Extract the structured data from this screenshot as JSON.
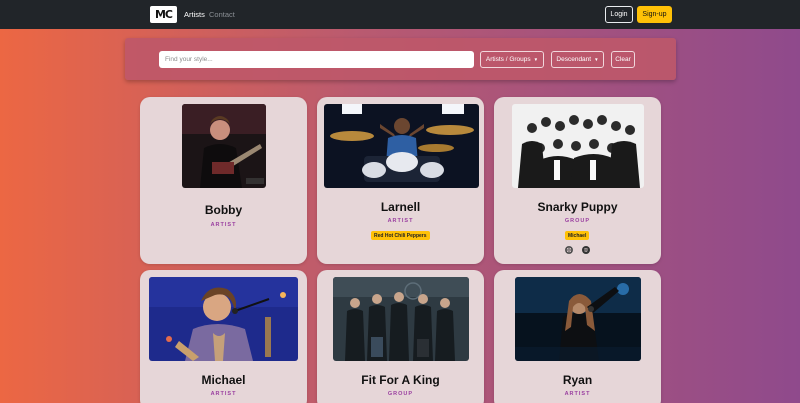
{
  "navbar": {
    "brand": "MC",
    "links": [
      "Artists",
      "Contact"
    ],
    "login_label": "Login",
    "signup_label": "Sign-up"
  },
  "filter": {
    "search_placeholder": "Find your style...",
    "type_label": "Artists / Groups",
    "order_label": "Descendant",
    "clear_label": "Clear"
  },
  "cards": [
    {
      "name": "Bobby",
      "kind": "ARTIST",
      "tags": [],
      "socials": []
    },
    {
      "name": "Larnell",
      "kind": "ARTIST",
      "tags": [
        "Red Hot Chili Peppers"
      ],
      "socials": []
    },
    {
      "name": "Snarky Puppy",
      "kind": "GROUP",
      "tags": [
        "Michael"
      ],
      "socials": [
        "instagram-icon",
        "spotify-icon"
      ]
    },
    {
      "name": "Michael",
      "kind": "ARTIST",
      "tags": [],
      "socials": []
    },
    {
      "name": "Fit For A King",
      "kind": "GROUP",
      "tags": [],
      "socials": []
    },
    {
      "name": "Ryan",
      "kind": "ARTIST",
      "tags": [],
      "socials": []
    }
  ],
  "colors": {
    "navbar": "#212529",
    "accent_yellow": "#ffc107",
    "kind_purple": "#9a3fa0",
    "card_bg": "#e6d6d8"
  }
}
